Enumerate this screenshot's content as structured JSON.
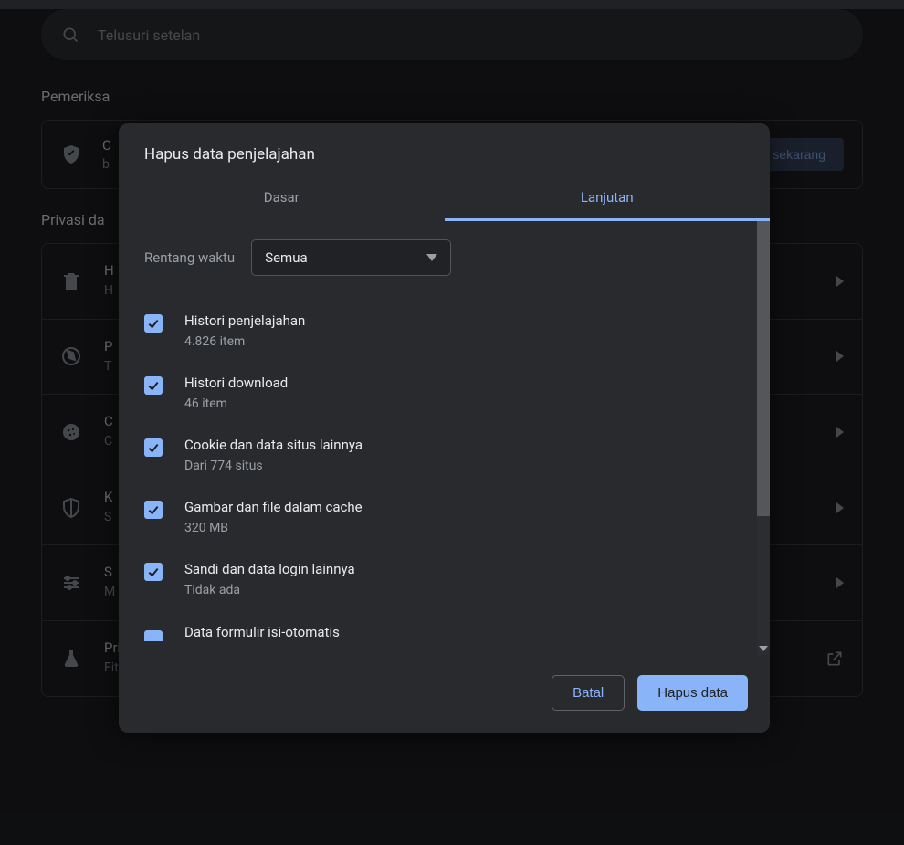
{
  "search": {
    "placeholder": "Telusuri setelan"
  },
  "sections": {
    "safety_check": "Pemeriksa",
    "privacy": "Privasi da"
  },
  "safety_card": {
    "line1": "C",
    "line2": "b",
    "button": "sa sekarang"
  },
  "rows": {
    "r1": {
      "title": "H",
      "sub": "H"
    },
    "r2": {
      "title": "P",
      "sub": "T"
    },
    "r3": {
      "title": "C",
      "sub": "C"
    },
    "r4": {
      "title": "K",
      "sub": "S"
    },
    "r5": {
      "title": "S",
      "sub": "M                                                                                                                           a, pop-up, dan lainnya)"
    },
    "r6": {
      "title": "Privacy Sandbox",
      "sub": "Fitur uji coba aktif"
    }
  },
  "dialog": {
    "title": "Hapus data penjelajahan",
    "tabs": {
      "basic": "Dasar",
      "advanced": "Lanjutan"
    },
    "range_label": "Rentang waktu",
    "range_value": "Semua",
    "options": [
      {
        "title": "Histori penjelajahan",
        "sub": "4.826 item"
      },
      {
        "title": "Histori download",
        "sub": "46 item"
      },
      {
        "title": "Cookie dan data situs lainnya",
        "sub": "Dari 774 situs"
      },
      {
        "title": "Gambar dan file dalam cache",
        "sub": "320 MB"
      },
      {
        "title": "Sandi dan data login lainnya",
        "sub": "Tidak ada"
      }
    ],
    "partial_option": "Data formulir isi-otomatis",
    "cancel": "Batal",
    "confirm": "Hapus data"
  }
}
